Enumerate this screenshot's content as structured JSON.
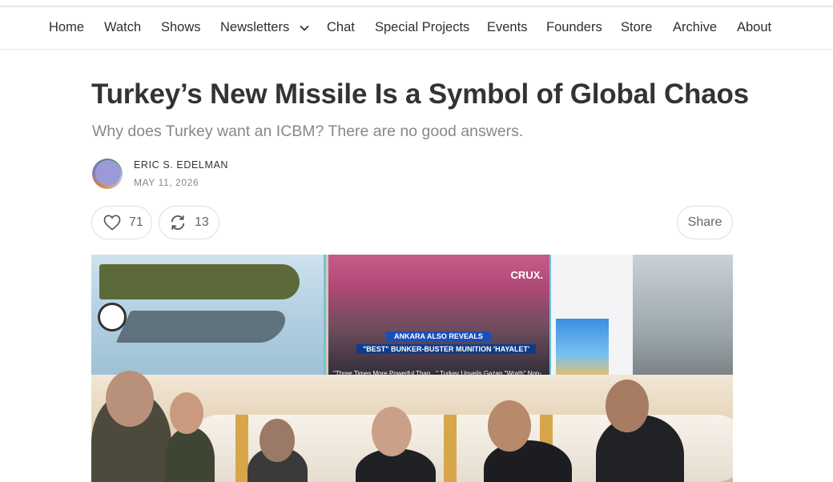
{
  "nav": {
    "items": [
      {
        "label": "Home"
      },
      {
        "label": "Watch"
      },
      {
        "label": "Shows"
      },
      {
        "label": "Newsletters",
        "has_dropdown": true
      },
      {
        "label": "Chat"
      },
      {
        "label": "Special Projects"
      },
      {
        "label": "Events"
      },
      {
        "label": "Founders"
      },
      {
        "label": "Store"
      },
      {
        "label": "Archive"
      },
      {
        "label": "About"
      }
    ]
  },
  "article": {
    "title": "Turkey’s New Missile Is a Symbol of Global Chaos",
    "subtitle": "Why does Turkey want an ICBM? There are no good answers.",
    "author": "ERIC S. EDELMAN",
    "date": "MAY 11, 2026",
    "likes": "71",
    "restacks": "13",
    "share_label": "Share"
  },
  "hero_image": {
    "screen_brand": "CRUX.",
    "banner_1": "ANKARA ALSO REVEALS",
    "banner_2": "\"BEST\" BUNKER-BUSTER MUNITION 'HAYALET'",
    "caption": "\"Three Times More Powerful Than...\" Turkey Unveils Gazap \"Wrath\" Non-"
  },
  "icons": {
    "like": "heart-icon",
    "restack": "restack-icon",
    "dropdown": "chevron-down-icon"
  },
  "colors": {
    "text": "#333333",
    "muted": "#888888",
    "border": "#dedede"
  }
}
